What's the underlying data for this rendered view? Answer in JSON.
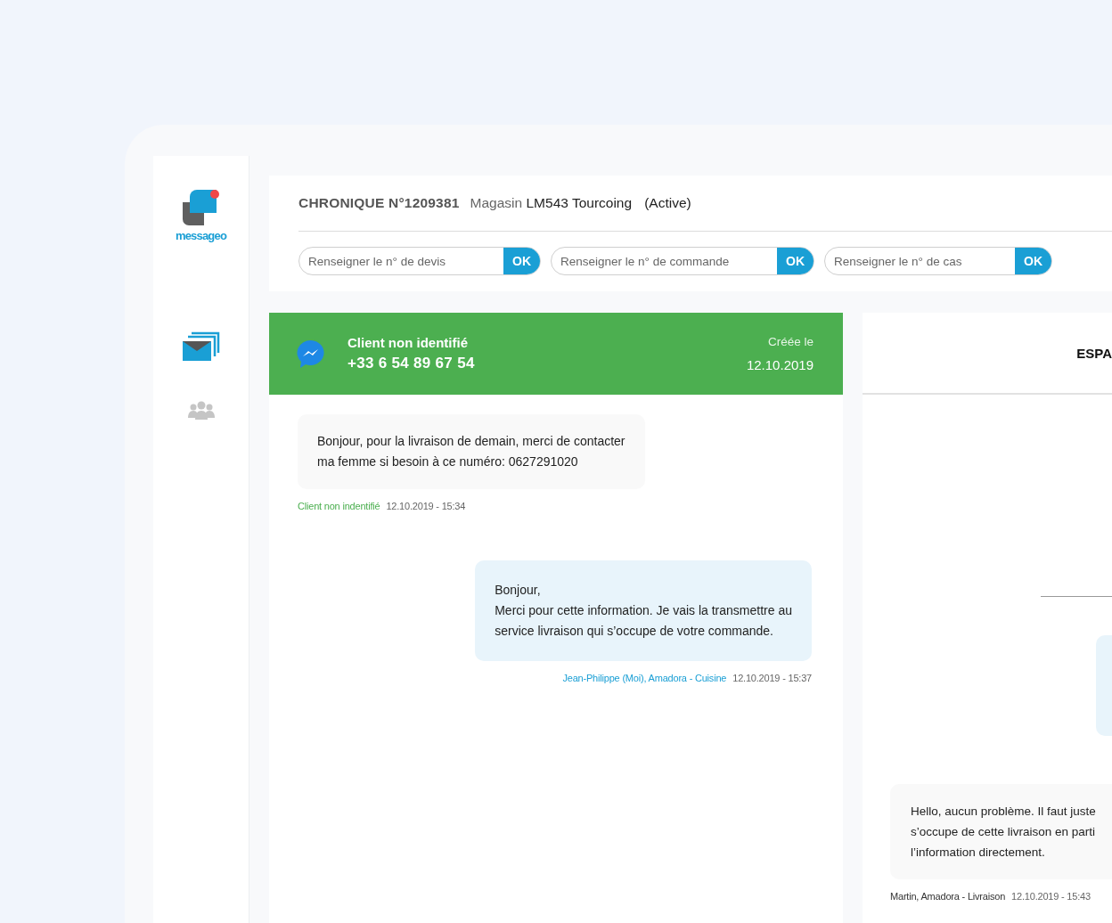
{
  "logo": {
    "text": "messageo"
  },
  "nav": [
    {
      "kind": "messages",
      "selected": true
    },
    {
      "kind": "contacts",
      "selected": false
    }
  ],
  "header": {
    "title": "CHRONIQUE N°1209381",
    "store_label": "Magasin",
    "store": "LM543 Tourcoing",
    "status": "(Active)",
    "fields": [
      {
        "placeholder": "Renseigner le n° de devis",
        "button": "OK"
      },
      {
        "placeholder": "Renseigner le n° de commande",
        "button": "OK"
      },
      {
        "placeholder": "Renseigner le n° de cas",
        "button": "OK"
      }
    ]
  },
  "conversation": {
    "contact": {
      "name": "Client non identifié",
      "phone": "+33 6 54 89 67 54",
      "created_label": "Créée le",
      "created_date": "12.10.2019"
    },
    "messages": [
      {
        "kind": "incoming",
        "lines": [
          "Bonjour, pour la livraison de demain, merci de contacter",
          "ma femme si besoin à ce numéro: 0627291020"
        ],
        "author": "Client non indentifié",
        "time": "12.10.2019 - 15:34"
      },
      {
        "kind": "outgoing",
        "lines": [
          "Bonjour,",
          "Merci pour cette information. Je vais la transmettre au",
          "service livraison qui s’occupe de votre commande."
        ],
        "author": "Jean-Philippe (Moi), Amadora - Cuisine",
        "time": "12.10.2019 - 15:37"
      }
    ]
  },
  "side_panel": {
    "title": "ESPA",
    "messages": [
      {
        "kind": "internal",
        "lines": [
          "Hello, aucun problème. Il faut juste",
          "s’occupe de cette livraison en parti",
          "l’information directement."
        ],
        "author": "Martin, Amadora - Livraison",
        "time": "12.10.2019 - 15:43"
      }
    ]
  }
}
